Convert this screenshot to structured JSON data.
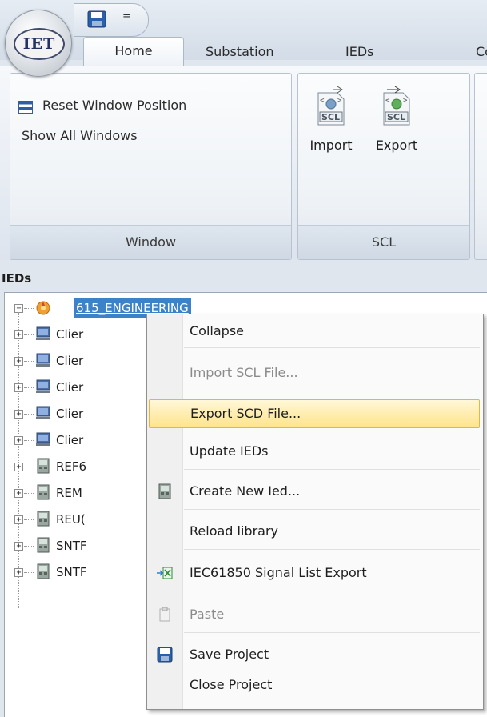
{
  "app": {
    "logo_text": "IET"
  },
  "quick_access": {
    "overflow_glyph": "="
  },
  "tabs": [
    "Home",
    "Substation",
    "IEDs",
    "Co"
  ],
  "ribbon": {
    "window_group": {
      "label": "Window",
      "reset": "Reset Window Position",
      "show_all": "Show All Windows"
    },
    "scl_group": {
      "label": "SCL",
      "import": "Import",
      "export": "Export"
    }
  },
  "panel": {
    "title": "IEDs"
  },
  "tree": {
    "root": "615_ENGINEERING",
    "children": [
      "Clier",
      "Clier",
      "Clier",
      "Clier",
      "Clier",
      "REF6",
      "REM",
      "REU(",
      "SNTF",
      "SNTF"
    ]
  },
  "context_menu": {
    "items": [
      {
        "label": "Collapse",
        "disabled": false,
        "icon": ""
      },
      {
        "label": "Import SCL File...",
        "disabled": true,
        "icon": ""
      },
      {
        "label": "Export SCD File...",
        "disabled": false,
        "icon": "",
        "highlighted": true
      },
      {
        "label": "Update IEDs",
        "disabled": false,
        "icon": ""
      },
      {
        "label": "Create New Ied...",
        "disabled": false,
        "icon": "ied-device-icon"
      },
      {
        "label": "Reload library",
        "disabled": false,
        "icon": ""
      },
      {
        "label": "IEC61850 Signal List Export",
        "disabled": false,
        "icon": "excel-export-icon"
      },
      {
        "label": "Paste",
        "disabled": true,
        "icon": "paste-icon"
      },
      {
        "label": "Save Project",
        "disabled": false,
        "icon": "save-icon"
      },
      {
        "label": "Close Project",
        "disabled": false,
        "icon": ""
      }
    ]
  },
  "colors": {
    "highlight": "#ffe48a",
    "selection": "#3b82c9",
    "ribbon_bg": "#dde4ee"
  }
}
